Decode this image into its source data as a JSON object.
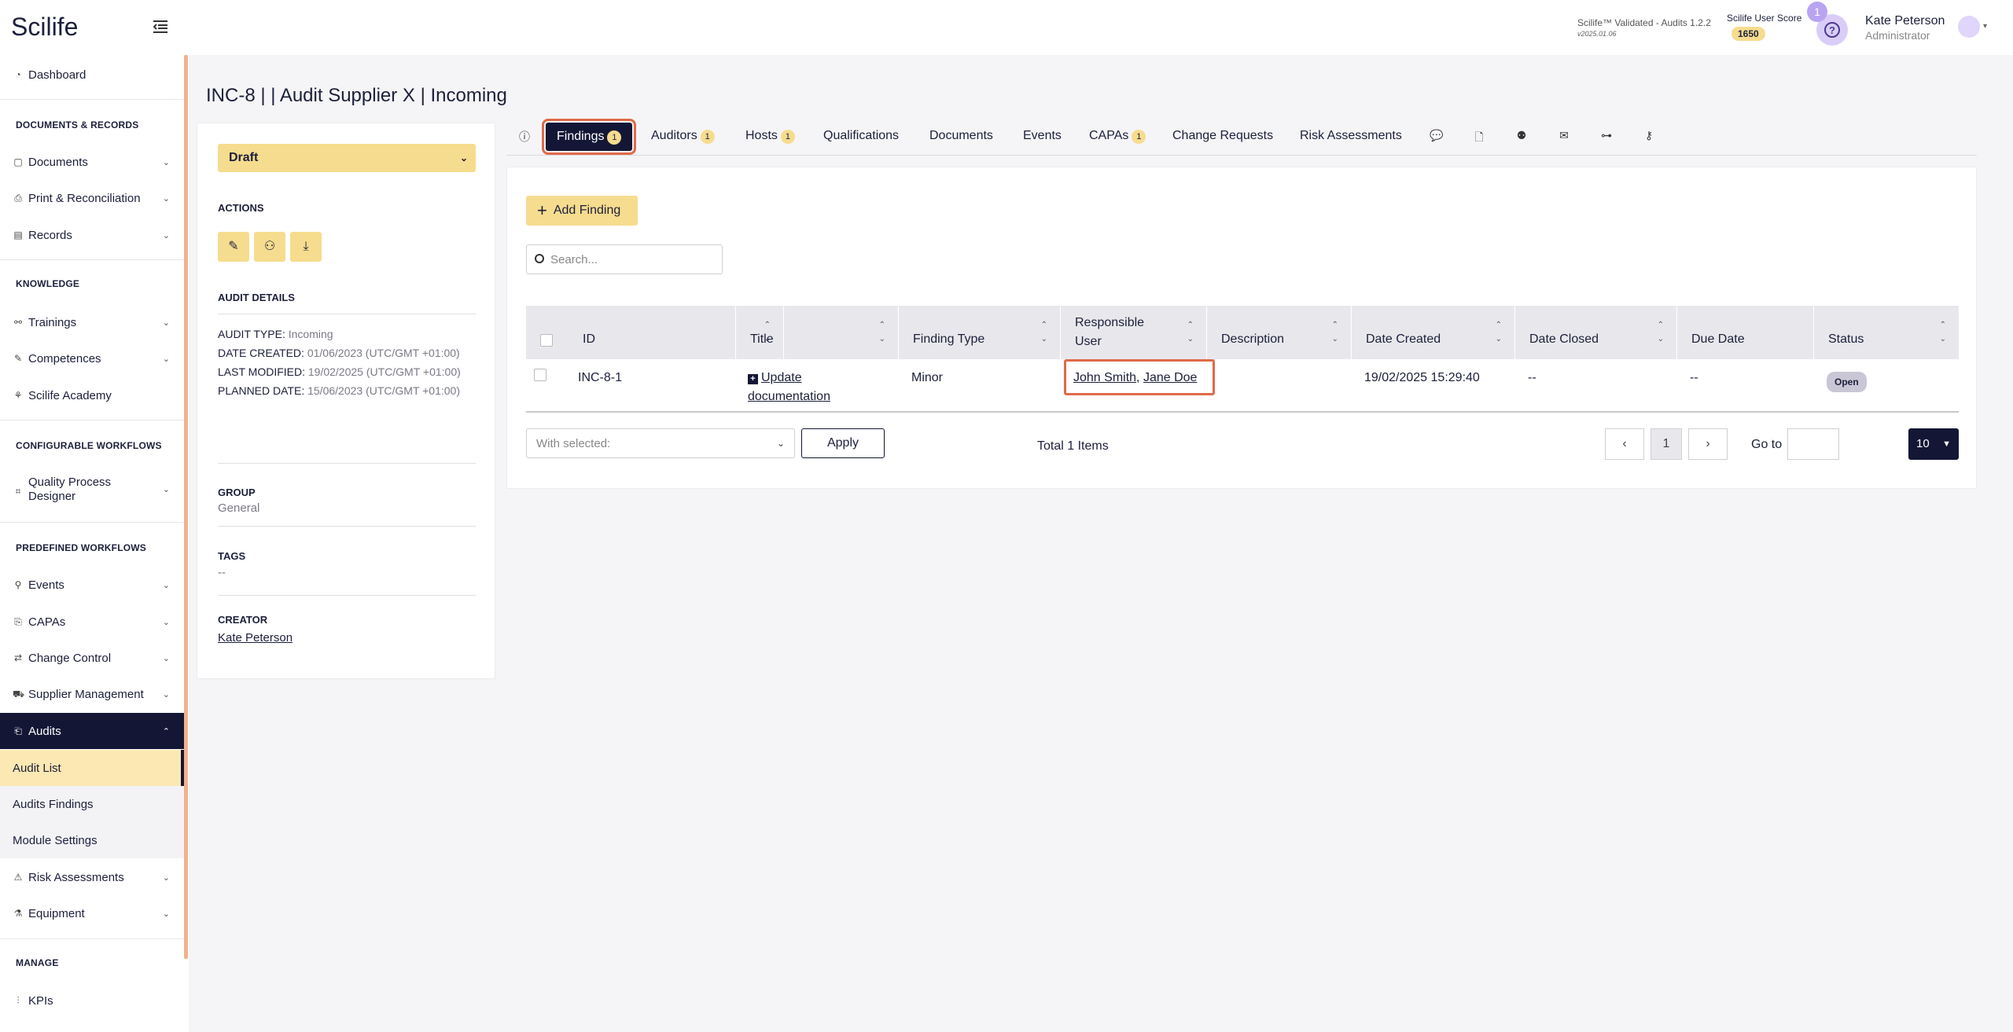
{
  "header": {
    "logo": "Scilife",
    "validated": "Scilife™ Validated - Audits 1.2.2",
    "validated_date": "v2025.01.06",
    "score_label": "Scilife User Score",
    "score_value": "1650",
    "notif_count": "1",
    "help": "?",
    "user_name": "Kate Peterson",
    "user_role": "Administrator"
  },
  "sidebar": {
    "dashboard": "Dashboard",
    "sec_docs": "DOCUMENTS & RECORDS",
    "documents": "Documents",
    "print": "Print & Reconciliation",
    "records": "Records",
    "sec_knowledge": "KNOWLEDGE",
    "trainings": "Trainings",
    "competences": "Competences",
    "academy": "Scilife Academy",
    "sec_config": "CONFIGURABLE WORKFLOWS",
    "qpd": "Quality Process Designer",
    "sec_predef": "PREDEFINED WORKFLOWS",
    "events": "Events",
    "capas": "CAPAs",
    "change_control": "Change Control",
    "supplier": "Supplier Management",
    "audits": "Audits",
    "audit_list": "Audit List",
    "audits_findings": "Audits Findings",
    "module_settings": "Module Settings",
    "risk": "Risk Assessments",
    "equipment": "Equipment",
    "sec_manage": "MANAGE",
    "kpis": "KPIs"
  },
  "page": {
    "title": "INC-8 |  |  Audit Supplier X |  Incoming"
  },
  "left_panel": {
    "status": "Draft",
    "actions_heading": "ACTIONS",
    "details_heading": "AUDIT DETAILS",
    "audit_type_label": "AUDIT TYPE:",
    "audit_type_value": "Incoming",
    "date_created_label": "DATE CREATED:",
    "date_created_value": "01/06/2023 (UTC/GMT +01:00)",
    "last_modified_label": "LAST MODIFIED:",
    "last_modified_value": "19/02/2025 (UTC/GMT +01:00)",
    "planned_date_label": "PLANNED DATE:",
    "planned_date_value": "15/06/2023 (UTC/GMT +01:00)",
    "group_heading": "GROUP",
    "group_value": "General",
    "tags_heading": "TAGS",
    "tags_value": "--",
    "creator_heading": "CREATOR",
    "creator_value": "Kate Peterson"
  },
  "tabs": {
    "findings": "Findings",
    "findings_count": "1",
    "auditors": "Auditors",
    "auditors_count": "1",
    "hosts": "Hosts",
    "hosts_count": "1",
    "qualifications": "Qualifications",
    "documents": "Documents",
    "events": "Events",
    "capas": "CAPAs",
    "capas_count": "1",
    "change_requests": "Change Requests",
    "risk_assessments": "Risk Assessments"
  },
  "findings": {
    "add_label": "Add Finding",
    "search_placeholder": "Search...",
    "columns": {
      "id": "ID",
      "title": "Title",
      "finding_type": "Finding Type",
      "responsible_user": "Responsible User",
      "description": "Description",
      "date_created": "Date Created",
      "date_closed": "Date Closed",
      "due_date": "Due Date",
      "status": "Status"
    },
    "row": {
      "id": "INC-8-1",
      "title_line1": "Update",
      "title_line2": "documentation",
      "finding_type": "Minor",
      "user1": "John Smith",
      "sep": ",",
      "user2": "Jane Doe",
      "description": "",
      "date_created": "19/02/2025 15:29:40",
      "date_closed": "--",
      "due_date": "--",
      "status": "Open"
    },
    "with_selected": "With selected:",
    "apply": "Apply",
    "total": "Total 1 Items",
    "page": "1",
    "goto": "Go to",
    "page_size": "10"
  },
  "colors": {
    "accent_yellow": "#f6dc8e",
    "navy": "#131735",
    "highlight": "#e06a4a"
  }
}
